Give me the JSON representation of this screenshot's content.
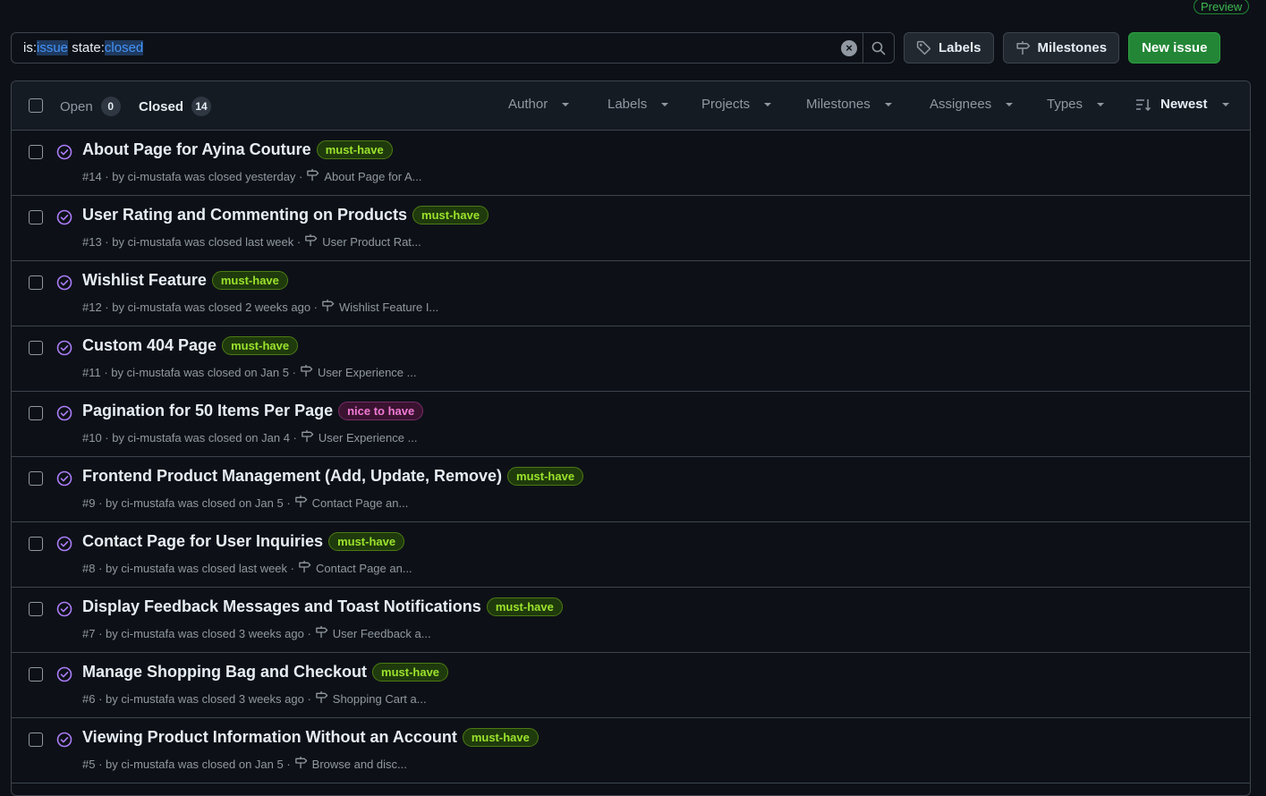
{
  "preview_badge": "Preview",
  "search": {
    "prefix1": "is:",
    "value1": "issue",
    "prefix2": " state:",
    "value2": "closed"
  },
  "toolbar": {
    "labels_label": "Labels",
    "milestones_label": "Milestones",
    "new_issue_label": "New issue"
  },
  "colors": {
    "must_have_bg": "#1f3a0c",
    "must_have_fg": "#9be22d",
    "must_have_border": "#4d7a14",
    "nice_bg": "#3a1330",
    "nice_fg": "#f07ad4",
    "nice_border": "#7a2b68",
    "closed_icon": "#ab7df8"
  },
  "tabs": {
    "open_label": "Open",
    "open_count": "0",
    "closed_label": "Closed",
    "closed_count": "14"
  },
  "filters": {
    "author": "Author",
    "labels": "Labels",
    "projects": "Projects",
    "milestones": "Milestones",
    "assignees": "Assignees",
    "types": "Types",
    "sort": "Newest"
  },
  "issues": [
    {
      "title": "About Page for Ayina Couture",
      "label": "must-have",
      "label_type": "must",
      "meta": "#14 · by ci-mustafa was closed yesterday ·",
      "milestone": "About Page for A..."
    },
    {
      "title": "User Rating and Commenting on Products",
      "label": "must-have",
      "label_type": "must",
      "meta": "#13 · by ci-mustafa was closed last week ·",
      "milestone": "User Product Rat..."
    },
    {
      "title": "Wishlist Feature",
      "label": "must-have",
      "label_type": "must",
      "meta": "#12 · by ci-mustafa was closed 2 weeks ago ·",
      "milestone": "Wishlist Feature I..."
    },
    {
      "title": "Custom 404 Page",
      "label": "must-have",
      "label_type": "must",
      "meta": "#11 · by ci-mustafa was closed on Jan 5 ·",
      "milestone": "User Experience ..."
    },
    {
      "title": "Pagination for 50 Items Per Page",
      "label": "nice to have",
      "label_type": "nice",
      "meta": "#10 · by ci-mustafa was closed on Jan 4 ·",
      "milestone": "User Experience ..."
    },
    {
      "title": "Frontend Product Management (Add, Update, Remove)",
      "label": "must-have",
      "label_type": "must",
      "meta": "#9 · by ci-mustafa was closed on Jan 5 ·",
      "milestone": "Contact Page an..."
    },
    {
      "title": "Contact Page for User Inquiries",
      "label": "must-have",
      "label_type": "must",
      "meta": "#8 · by ci-mustafa was closed last week ·",
      "milestone": "Contact Page an..."
    },
    {
      "title": "Display Feedback Messages and Toast Notifications",
      "label": "must-have",
      "label_type": "must",
      "meta": "#7 · by ci-mustafa was closed 3 weeks ago ·",
      "milestone": "User Feedback a..."
    },
    {
      "title": "Manage Shopping Bag and Checkout",
      "label": "must-have",
      "label_type": "must",
      "meta": "#6 · by ci-mustafa was closed 3 weeks ago ·",
      "milestone": "Shopping Cart a..."
    },
    {
      "title": "Viewing Product Information Without an Account",
      "label": "must-have",
      "label_type": "must",
      "meta": "#5 · by ci-mustafa was closed on Jan 5 ·",
      "milestone": "Browse and disc..."
    }
  ]
}
